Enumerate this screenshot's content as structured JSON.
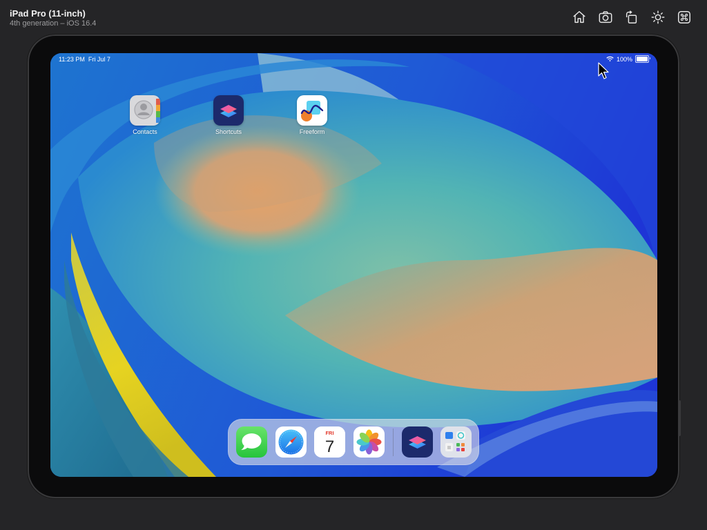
{
  "window": {
    "title": "iPad Pro (11-inch)",
    "subtitle": "4th generation – iOS 16.4"
  },
  "toolbar": {
    "buttons": [
      {
        "icon": "home-icon"
      },
      {
        "icon": "screenshot-icon"
      },
      {
        "icon": "rotate-icon"
      },
      {
        "icon": "appearance-icon"
      },
      {
        "icon": "command-icon"
      }
    ]
  },
  "statusbar": {
    "time": "11:23 PM",
    "date": "Fri Jul 7",
    "battery": "100%",
    "battery_level": 1.0
  },
  "home_apps": [
    {
      "label": "Contacts",
      "icon": "contacts-icon"
    },
    {
      "label": "Shortcuts",
      "icon": "shortcuts-icon"
    },
    {
      "label": "Freeform",
      "icon": "freeform-icon"
    }
  ],
  "dock": {
    "apps": [
      {
        "icon": "messages-icon"
      },
      {
        "icon": "safari-icon"
      },
      {
        "icon": "calendar-icon",
        "weekday": "FRI",
        "day": "7"
      },
      {
        "icon": "photos-icon"
      },
      {
        "icon": "shortcuts-icon"
      },
      {
        "icon": "app-library-icon"
      }
    ]
  },
  "colors": {
    "background": "#252527",
    "wallpaper_blue": "#1a4fc9",
    "accent_red": "#e33b2e"
  }
}
